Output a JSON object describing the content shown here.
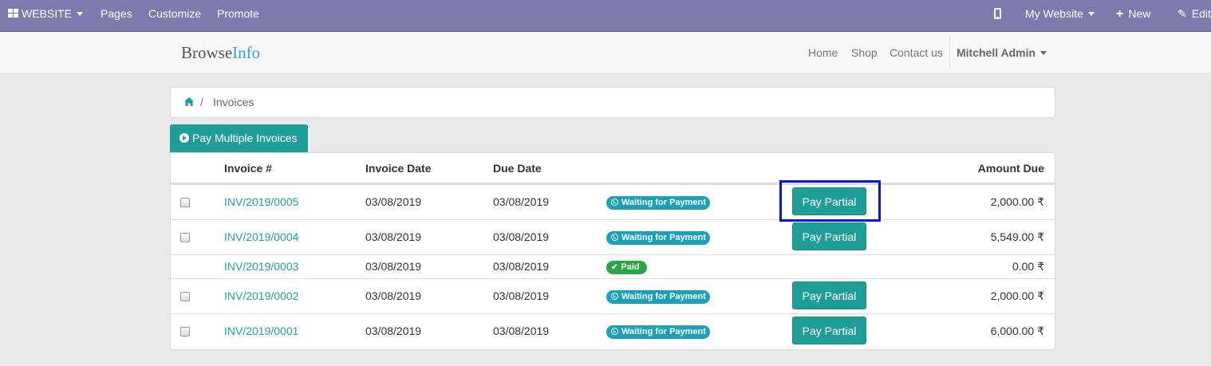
{
  "topbar": {
    "website": "WEBSITE",
    "pages": "Pages",
    "customize": "Customize",
    "promote": "Promote",
    "my_website": "My Website",
    "new": "New",
    "edit": "Edit"
  },
  "header": {
    "brand_part1": "Browse",
    "brand_part2": "Info",
    "nav": [
      "Home",
      "Shop",
      "Contact us"
    ],
    "user": "Mitchell Admin"
  },
  "breadcrumb": {
    "separator": "/",
    "current": "Invoices"
  },
  "pay_multiple_label": "Pay Multiple Invoices",
  "table": {
    "headers": {
      "invoice": "Invoice #",
      "invoice_date": "Invoice Date",
      "due_date": "Due Date",
      "amount_due": "Amount Due"
    },
    "pay_partial_label": "Pay Partial",
    "rows": [
      {
        "number": "INV/2019/0005",
        "invoice_date": "03/08/2019",
        "due_date": "03/08/2019",
        "status": "Waiting for Payment",
        "amount": "2,000.00 ₹"
      },
      {
        "number": "INV/2019/0004",
        "invoice_date": "03/08/2019",
        "due_date": "03/08/2019",
        "status": "Waiting for Payment",
        "amount": "5,549.00 ₹"
      },
      {
        "number": "INV/2019/0003",
        "invoice_date": "03/08/2019",
        "due_date": "03/08/2019",
        "status": "Paid",
        "amount": "0.00 ₹"
      },
      {
        "number": "INV/2019/0002",
        "invoice_date": "03/08/2019",
        "due_date": "03/08/2019",
        "status": "Waiting for Payment",
        "amount": "2,000.00 ₹"
      },
      {
        "number": "INV/2019/0001",
        "invoice_date": "03/08/2019",
        "due_date": "03/08/2019",
        "status": "Waiting for Payment",
        "amount": "6,000.00 ₹"
      }
    ]
  },
  "colors": {
    "topbar": "#7c7bad",
    "primary": "#1f9e98",
    "waiting_badge": "#1ba0b9",
    "paid_badge": "#28a745",
    "highlight": "#0a18d6"
  }
}
